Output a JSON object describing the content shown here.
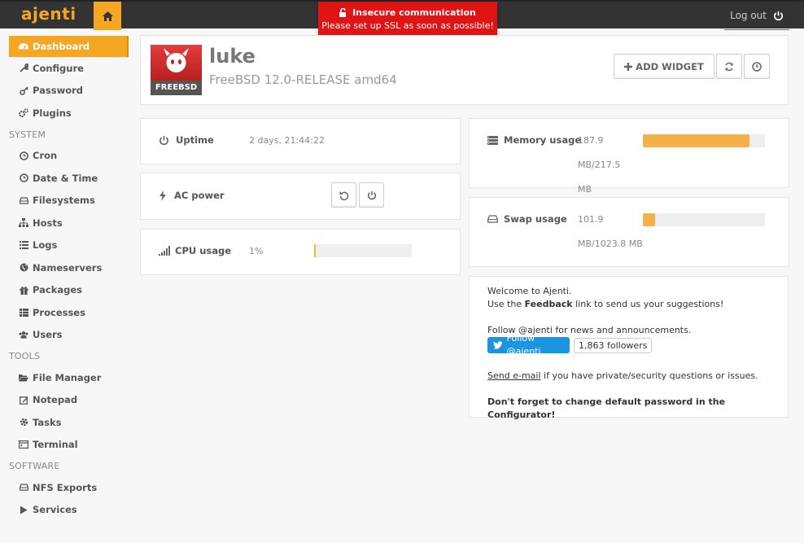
{
  "app": {
    "logo": "ajenti",
    "logout_label": "Log out"
  },
  "alert": {
    "title": "Insecure communication",
    "message": "Please set up SSL as soon as possible!"
  },
  "sidebar": {
    "items": [
      {
        "label": "Dashboard",
        "icon": "dashboard-icon"
      },
      {
        "label": "Configure",
        "icon": "wrench-icon"
      },
      {
        "label": "Password",
        "icon": "key-icon"
      },
      {
        "label": "Plugins",
        "icon": "gears-icon"
      }
    ],
    "sections": [
      {
        "title": "SYSTEM",
        "items": [
          {
            "label": "Cron",
            "icon": "clock-icon"
          },
          {
            "label": "Date & Time",
            "icon": "clock-icon"
          },
          {
            "label": "Filesystems",
            "icon": "hdd-icon"
          },
          {
            "label": "Hosts",
            "icon": "sitemap-icon"
          },
          {
            "label": "Logs",
            "icon": "list-icon"
          },
          {
            "label": "Nameservers",
            "icon": "globe-icon"
          },
          {
            "label": "Packages",
            "icon": "gift-icon"
          },
          {
            "label": "Processes",
            "icon": "table-icon"
          },
          {
            "label": "Users",
            "icon": "users-icon"
          }
        ]
      },
      {
        "title": "TOOLS",
        "items": [
          {
            "label": "File Manager",
            "icon": "folder-icon"
          },
          {
            "label": "Notepad",
            "icon": "edit-icon"
          },
          {
            "label": "Tasks",
            "icon": "gear-icon"
          },
          {
            "label": "Terminal",
            "icon": "terminal-icon"
          }
        ]
      },
      {
        "title": "SOFTWARE",
        "items": [
          {
            "label": "NFS Exports",
            "icon": "hdd-icon"
          },
          {
            "label": "Services",
            "icon": "play-icon"
          }
        ]
      }
    ]
  },
  "host": {
    "name": "luke",
    "os": "FreeBSD 12.0-RELEASE amd64",
    "badge": "FREEBSD",
    "add_widget_label": "ADD WIDGET"
  },
  "widgets": {
    "uptime": {
      "label": "Uptime",
      "value": "2 days, 21:44:22"
    },
    "ac_power": {
      "label": "AC power"
    },
    "cpu": {
      "label": "CPU usage",
      "value": "1%",
      "fraction": 0.01
    },
    "memory": {
      "label": "Memory usage",
      "value_line1": "187.9 MB/217.5",
      "value_line2": "MB",
      "fraction": 0.87
    },
    "swap": {
      "label": "Swap usage",
      "value_line1": "101.9",
      "value_line2": "MB/1023.8 MB",
      "fraction": 0.1
    }
  },
  "welcome": {
    "line1": "Welcome to Ajenti.",
    "line2_pre": "Use the ",
    "line2_bold": "Feedback",
    "line2_post": " link to send us your suggestions!",
    "follow_text": "Follow @ajenti for news and announcements.",
    "follow_button": "Follow @ajenti",
    "followers": "1,863 followers",
    "email_link": "Send e-mail",
    "email_post": " if you have private/security questions or issues.",
    "password_note": "Don't forget to change default password in the Configurator!"
  },
  "colors": {
    "accent": "#f5a623",
    "topbar": "#333333",
    "alert": "#e01414",
    "bar_fill": "#f5b14a"
  }
}
